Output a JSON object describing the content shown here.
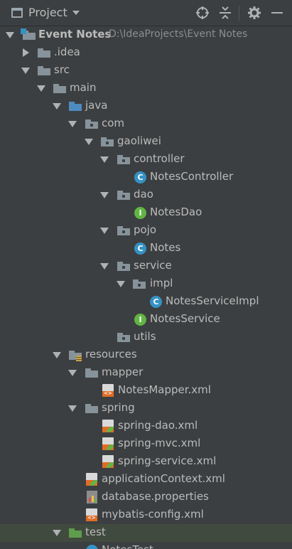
{
  "header": {
    "title": "Project",
    "icons": [
      "locate-icon",
      "collapse-all-icon",
      "gear-icon",
      "minimize-icon"
    ]
  },
  "tree": {
    "root": {
      "name": "Event Notes",
      "path": "D:\\IdeaProjects\\Event Notes"
    },
    "idea": ".idea",
    "src": "src",
    "main": "main",
    "java": "java",
    "com": "com",
    "gaoliwei": "gaoliwei",
    "controller": "controller",
    "notes_controller": "NotesController",
    "dao": "dao",
    "notes_dao": "NotesDao",
    "pojo": "pojo",
    "notes": "Notes",
    "service": "service",
    "impl": "impl",
    "notes_service_impl": "NotesServiceImpl",
    "notes_service": "NotesService",
    "utils": "utils",
    "resources": "resources",
    "mapper": "mapper",
    "notes_mapper_xml": "NotesMapper.xml",
    "spring": "spring",
    "spring_dao_xml": "spring-dao.xml",
    "spring_mvc_xml": "spring-mvc.xml",
    "spring_service_xml": "spring-service.xml",
    "application_context_xml": "applicationContext.xml",
    "database_properties": "database.properties",
    "mybatis_config_xml": "mybatis-config.xml",
    "test": "test",
    "notes_test": "NotesTest"
  }
}
